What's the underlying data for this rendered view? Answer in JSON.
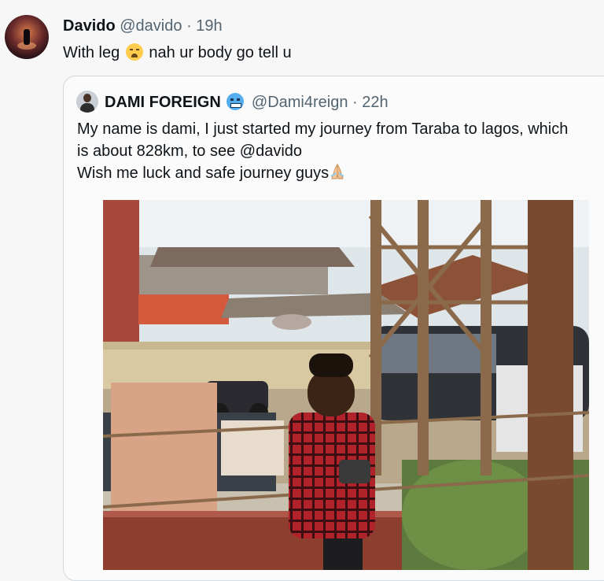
{
  "tweet": {
    "author_name": "Davido",
    "handle": "@davido",
    "separator": "·",
    "time": "19h",
    "text_before": "With leg",
    "text_after": "nah ur body go tell u",
    "emoji": "loudly-crying-face"
  },
  "quoted_tweet": {
    "author_name": "DAMI FOREIGN",
    "badge_emoji": "cold-face",
    "handle": "@Dami4reign",
    "separator": "·",
    "time": "22h",
    "line1": "My name is dami, I just started my journey from Taraba to lagos, which",
    "line2": "is about 828km, to see @davido",
    "line3": "Wish me luck and safe journey guys",
    "trailing_emoji": "folded-hands",
    "media": "photo-man-in-red-plaid-shirt-by-fence"
  },
  "colors": {
    "background": "#f7f7f8",
    "text": "#0f1419",
    "secondary": "#536471",
    "border": "#cfd9de"
  }
}
